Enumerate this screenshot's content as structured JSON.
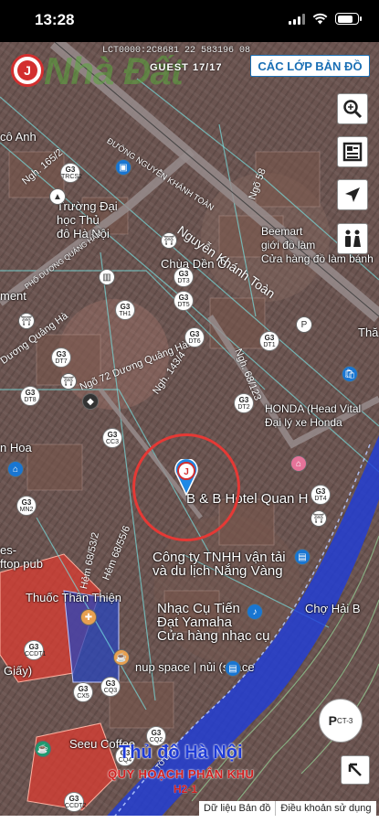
{
  "status_bar": {
    "time": "13:28"
  },
  "header": {
    "watermark": "Nhà Đất",
    "plan_id": "LCT0000:2C8681 22 583196 08",
    "guest": "GUEST 17/17",
    "layers_button": "CÁC LỚP BẢN ĐỒ"
  },
  "map_labels": {
    "school": "Trường Đại\nhọc Thủ\nđô Hà Nội",
    "pagoda": "Chùa Dền Ỗ",
    "street_nguyen_khanh_toan": "Nguyễn Khánh Toàn",
    "street_nguyen_khanh_toan_upper": "ĐƯỜNG NGUYỄN KHÁNH TOÀN",
    "street_quang_ham": "PHỐ DƯƠNG QUẢNG HÀM",
    "lane_165": "Ngh. 165/2",
    "lane_58": "Ngõ 58",
    "lane_143": "Ngh. 143/4",
    "lane_68_123": "Ngh. 68/123",
    "lane_72": "Ngõ 72 Dương Quảng Hàm",
    "lane_quang_ha": "Dương Quảng Hà",
    "beemart": "Beemart\ngiới đồ làm\nCửa hàng đồ làm bánh",
    "honda": "HONDA (Head Vital\nĐại lý xe Honda",
    "hotel": "B & B Hotel Quan H",
    "company": "Công ty TNHH vận tải\nvà du lịch Nắng Vàng",
    "music": "Nhạc Cụ Tiến\nĐạt Yamaha\nCửa hàng nhạc cụ",
    "space": "nup space | nủi (space",
    "thuoc": "Thuốc Thân Thiện",
    "seeu": "Seeu Coffee",
    "pub": "es-\nftop pub",
    "hoa": "n Hoa",
    "ment": "ment",
    "cho": "Chợ Hải B",
    "lane_53": "Hẻm 68/53/2",
    "lane_55": "Hẻm 68/55/6",
    "giay": "Giấy)",
    "tha": "Thă",
    "co_anh": "cô Anh",
    "to_lich": "TÔ LỊCH"
  },
  "g3_markers": [
    {
      "code": "TRCS2"
    },
    {
      "code": "DT3"
    },
    {
      "code": "DT5"
    },
    {
      "code": "TH1"
    },
    {
      "code": "DT6"
    },
    {
      "code": "DT7"
    },
    {
      "code": "DT8"
    },
    {
      "code": "DT1"
    },
    {
      "code": "DT2"
    },
    {
      "code": "CC3"
    },
    {
      "code": "MN2"
    },
    {
      "code": "CX5"
    },
    {
      "code": "CQ3"
    },
    {
      "code": "CQ4"
    },
    {
      "code": "CQ2"
    },
    {
      "code": "CCDT1"
    },
    {
      "code": "CCDT2"
    },
    {
      "code": "DT4"
    }
  ],
  "controls": {
    "pct_button": "P",
    "pct_sub": "CT-3"
  },
  "overlay": {
    "city": "Thủ đô Hà Nội",
    "plan": "QUY HOẠCH PHÂN KHU",
    "sub": "H2-1"
  },
  "footer": {
    "data_label": "Dữ liệu Bản đồ",
    "terms_label": "Điều khoản sử dụng"
  },
  "colors": {
    "accent": "#1a6fb5",
    "red": "#e53935",
    "river_blue": "#1e3bd8"
  }
}
